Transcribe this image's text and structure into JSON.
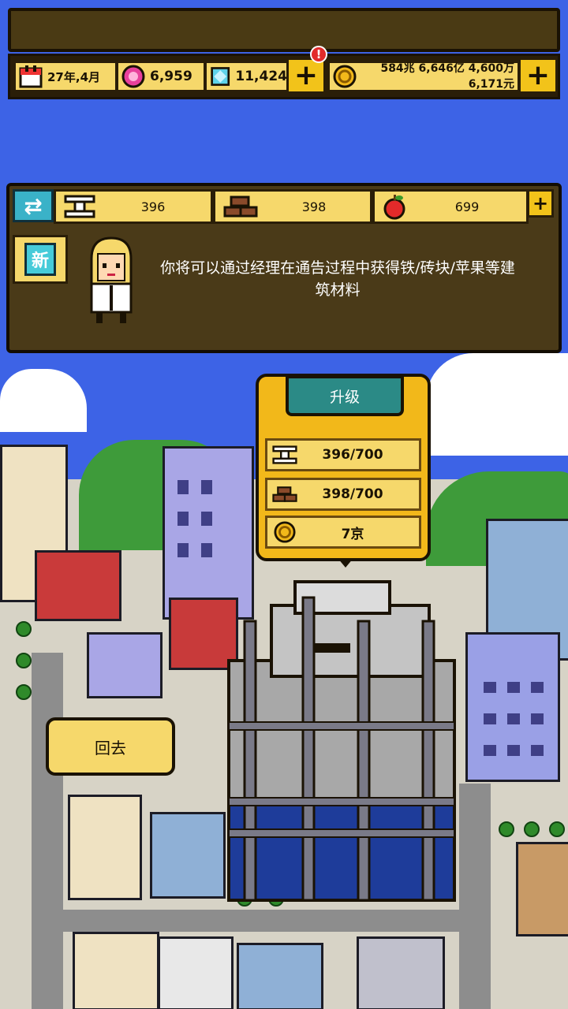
{
  "top_bar": {
    "date": "27年,4月",
    "pink_gems": "6,959",
    "blue_gems": "11,424",
    "notification": "!",
    "money_line1": "584兆 6,646亿 4,600万",
    "money_line2": "6,171元",
    "plus_label": "+"
  },
  "materials": {
    "swap_label": "⇄",
    "iron": "396",
    "bricks": "398",
    "apples": "699",
    "plus_label": "+",
    "new_badge": "新",
    "message": "你将可以通过经理在通告过程中获得铁/砖块/苹果等建筑材料"
  },
  "upgrade_popup": {
    "button_label": "升级",
    "requirements": [
      {
        "icon": "iron-beam-icon",
        "value": "396/700"
      },
      {
        "icon": "brick-icon",
        "value": "398/700"
      },
      {
        "icon": "coin-icon",
        "value": "7京"
      }
    ]
  },
  "back_button": "回去",
  "colors": {
    "sky": "#3d63e6",
    "panel": "#4a3a18",
    "pill": "#f6d86b",
    "accent_yellow": "#f2c31a",
    "teal": "#2b8a86"
  }
}
